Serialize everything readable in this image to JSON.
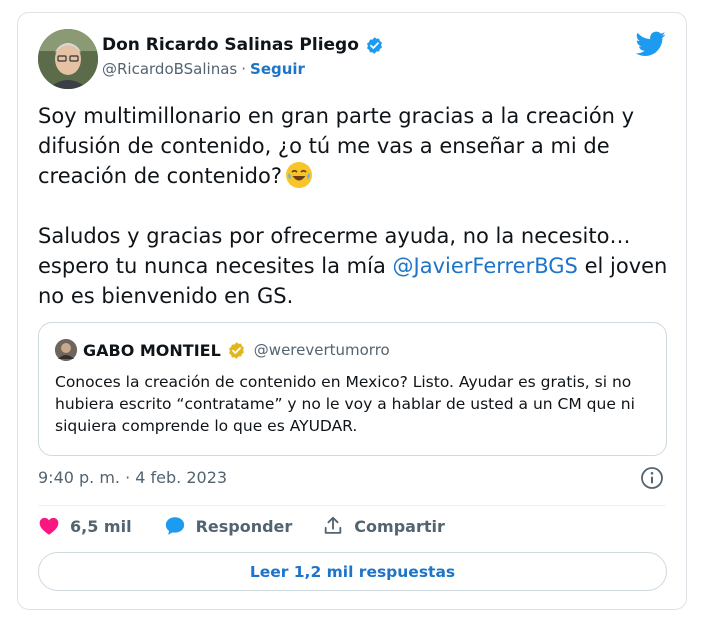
{
  "author": {
    "name": "Don Ricardo Salinas Pliego",
    "handle": "@RicardoBSalinas",
    "separator": "·",
    "follow_label": "Seguir"
  },
  "tweet": {
    "paragraph1": "Soy multimillonario en gran parte gracias a la creación y difusión de contenido, ¿o tú me vas a enseñar a mi de creación de contenido?",
    "paragraph2_before": "Saludos y gracias por ofrecerme ayuda, no la necesito… espero tu nunca necesites la mía",
    "mention": "@JavierFerrerBGS",
    "paragraph2_after": "el joven no es bienvenido en GS."
  },
  "quote": {
    "name": "GABO MONTIEL",
    "handle": "@werevertumorro",
    "text": "Conoces la creación de contenido en Mexico? Listo. Ayudar es gratis, si no hubiera escrito “contratame” y no le voy a hablar de usted a un CM que ni siquiera comprende lo que es AYUDAR."
  },
  "timestamp": "9:40 p. m. · 4 feb. 2023",
  "actions": {
    "likes": "6,5 mil",
    "reply": "Responder",
    "share": "Compartir"
  },
  "read_replies_label": "Leer 1,2 mil respuestas",
  "icons": {
    "brand": "twitter-bird-icon",
    "verified": "verified-badge-icon",
    "like": "heart-icon",
    "reply": "speech-bubble-icon",
    "share": "share-upload-icon",
    "info": "info-icon",
    "emoji": "laughing-tears-emoji-icon"
  },
  "colors": {
    "accent": "#1d9bf0",
    "link": "#1d74c8",
    "like": "#f91880",
    "verified_gold": "#e2b719",
    "text_secondary": "#536471"
  }
}
